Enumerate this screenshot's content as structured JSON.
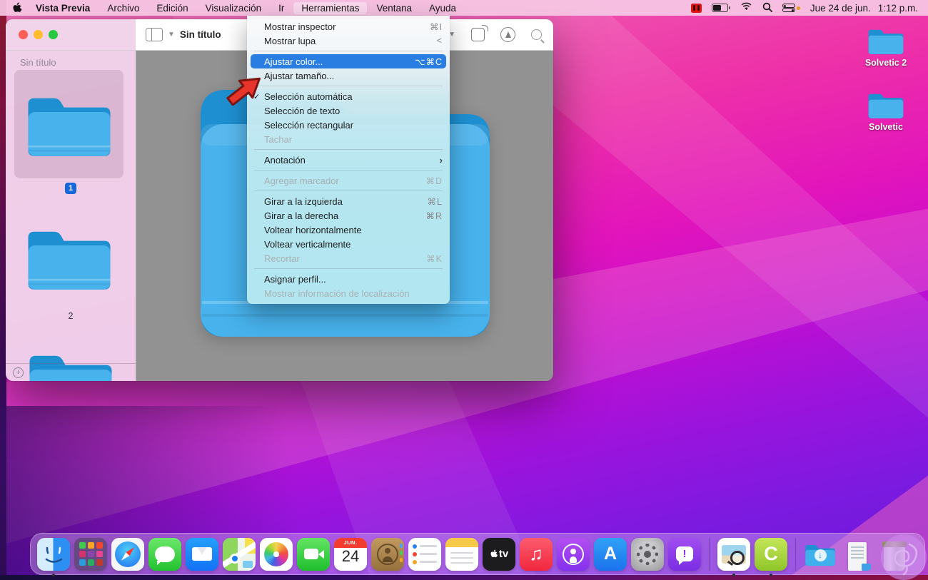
{
  "menubar": {
    "app_name": "Vista Previa",
    "menus": [
      {
        "label": "Archivo"
      },
      {
        "label": "Edición"
      },
      {
        "label": "Visualización"
      },
      {
        "label": "Ir"
      },
      {
        "label": "Herramientas",
        "active": true
      },
      {
        "label": "Ventana"
      },
      {
        "label": "Ayuda"
      }
    ],
    "status": {
      "date": "Jue 24 de jun.",
      "time": "1:12 p.m."
    }
  },
  "tools_menu": {
    "items": [
      {
        "label": "Mostrar inspector",
        "shortcut": "⌘I"
      },
      {
        "label": "Mostrar lupa",
        "shortcut": "<"
      },
      {
        "label": "Ajustar color...",
        "shortcut": "⌥⌘C",
        "highlighted": true
      },
      {
        "label": "Ajustar tamaño..."
      },
      {
        "label": "Selección automática",
        "checked": "✓"
      },
      {
        "label": "Selección de texto"
      },
      {
        "label": "Selección rectangular"
      },
      {
        "label": "Tachar",
        "disabled": true
      },
      {
        "label": "Anotación",
        "submenu": "›"
      },
      {
        "label": "Agregar marcador",
        "shortcut": "⌘D",
        "disabled": true
      },
      {
        "label": "Girar a la izquierda",
        "shortcut": "⌘L"
      },
      {
        "label": "Girar a la derecha",
        "shortcut": "⌘R"
      },
      {
        "label": "Voltear horizontalmente"
      },
      {
        "label": "Voltear verticalmente"
      },
      {
        "label": "Recortar",
        "shortcut": "⌘K",
        "disabled": true
      },
      {
        "label": "Asignar perfil..."
      },
      {
        "label": "Mostrar información de localización",
        "disabled": true
      }
    ]
  },
  "preview_window": {
    "title": "Sin título",
    "sidebar_header": "Sin título",
    "thumbnails": [
      {
        "label": "1",
        "selected": true
      },
      {
        "label": "2",
        "selected": false
      },
      {
        "label": "",
        "selected": false,
        "partial": true
      }
    ]
  },
  "desktop": {
    "icons": [
      {
        "label": "Solvetic 2"
      },
      {
        "label": "Solvetic"
      }
    ]
  },
  "dock": {
    "calendar": {
      "month": "JUN.",
      "day": "24"
    },
    "appstore_glyph": "A",
    "camtasia_glyph": "C",
    "music_glyph": "♫",
    "tv_glyph": "tv",
    "feedback_glyph": "!",
    "download_glyph": "↓",
    "items": [
      "finder",
      "launchpad",
      "safari",
      "messages",
      "mail",
      "maps",
      "photos",
      "facetime",
      "calendar",
      "contacts",
      "reminders",
      "notes",
      "apple-tv",
      "music",
      "podcasts",
      "app-store",
      "system-preferences",
      "feedback-assistant",
      "preview",
      "camtasia",
      "downloads",
      "documents",
      "trash"
    ],
    "running": [
      "finder",
      "preview",
      "camtasia"
    ]
  },
  "colors": {
    "menu_highlight": "#2a7de1",
    "folder_front": "#47b2ec",
    "folder_back": "#1e90d2",
    "badge_blue": "#1667d9",
    "wallpaper_top": "#ee31a8",
    "wallpaper_bottom": "#6d16d8",
    "annotation_arrow": "#e8352c"
  }
}
